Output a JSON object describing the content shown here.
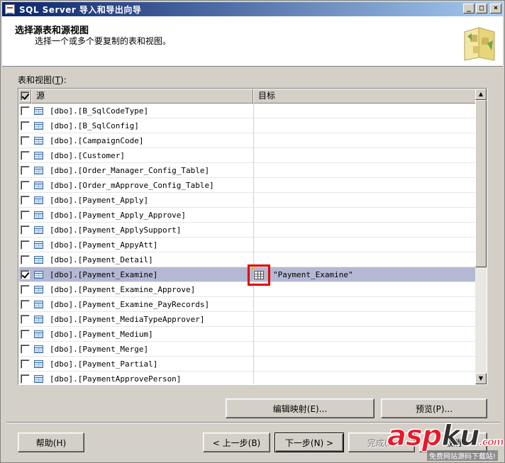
{
  "window": {
    "title": "SQL Server 导入和导出向导"
  },
  "titlebar_buttons": {
    "minimize": "_",
    "maximize": "□",
    "close": "×"
  },
  "header": {
    "title": "选择源表和源视图",
    "subtitle": "选择一个或多个要复制的表和视图。"
  },
  "list": {
    "label_prefix": "表和视图(",
    "label_key": "T",
    "label_suffix": "):",
    "columns": {
      "source": "源",
      "destination": "目标"
    },
    "rows": [
      {
        "source": "[dbo].[B_SqlCodeType]",
        "destination": "",
        "checked": false
      },
      {
        "source": "[dbo].[B_SqlConfig]",
        "destination": "",
        "checked": false
      },
      {
        "source": "[dbo].[CampaignCode]",
        "destination": "",
        "checked": false
      },
      {
        "source": "[dbo].[Customer]",
        "destination": "",
        "checked": false
      },
      {
        "source": "[dbo].[Order_Manager_Config_Table]",
        "destination": "",
        "checked": false
      },
      {
        "source": "[dbo].[Order_mApprove_Config_Table]",
        "destination": "",
        "checked": false
      },
      {
        "source": "[dbo].[Payment_Apply]",
        "destination": "",
        "checked": false
      },
      {
        "source": "[dbo].[Payment_Apply_Approve]",
        "destination": "",
        "checked": false
      },
      {
        "source": "[dbo].[Payment_ApplySupport]",
        "destination": "",
        "checked": false
      },
      {
        "source": "[dbo].[Payment_AppyAtt]",
        "destination": "",
        "checked": false
      },
      {
        "source": "[dbo].[Payment_Detail]",
        "destination": "",
        "checked": false
      },
      {
        "source": "[dbo].[Payment_Examine]",
        "destination": "\"Payment_Examine\"",
        "checked": true
      },
      {
        "source": "[dbo].[Payment_Examine_Approve]",
        "destination": "",
        "checked": false
      },
      {
        "source": "[dbo].[Payment_Examine_PayRecords]",
        "destination": "",
        "checked": false
      },
      {
        "source": "[dbo].[Payment_MediaTypeApprover]",
        "destination": "",
        "checked": false
      },
      {
        "source": "[dbo].[Payment_Medium]",
        "destination": "",
        "checked": false
      },
      {
        "source": "[dbo].[Payment_Merge]",
        "destination": "",
        "checked": false
      },
      {
        "source": "[dbo].[Payment_Partial]",
        "destination": "",
        "checked": false
      },
      {
        "source": "[dbo].[PaymentApprovePerson]",
        "destination": "",
        "checked": false
      }
    ]
  },
  "buttons": {
    "edit_mappings": "编辑映射(E)...",
    "preview": "预览(P)...",
    "help": "帮助(H)",
    "back": "< 上一步(B)",
    "next": "下一步(N) >",
    "finish": "完成(F)",
    "cancel": "取消"
  },
  "watermark": {
    "logo_a": "asp",
    "logo_b": "ku",
    "logo_c": ".com",
    "sub": "免费网站源码下载站!"
  },
  "icons": {
    "table": "table-icon",
    "mapping": "column-mapping-icon"
  },
  "colors": {
    "selection": "#b4b8d3",
    "highlight_box": "#e30000",
    "titlebar": "#0a246a"
  }
}
